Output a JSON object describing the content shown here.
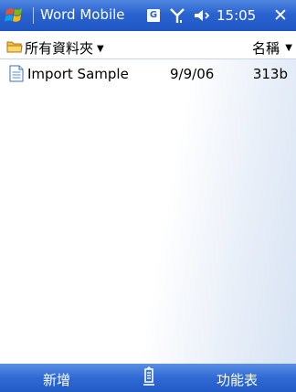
{
  "titlebar": {
    "app_title": "Word Mobile",
    "g_badge": "G",
    "time": "15:05",
    "close_glyph": "✕",
    "icons": [
      "windows-start-icon",
      "g-badge-icon",
      "signal-icon",
      "speaker-icon",
      "close-icon"
    ]
  },
  "folder_bar": {
    "folder_label": "所有資料夾",
    "sort_label": "名稱",
    "caret": "▼"
  },
  "files": [
    {
      "name": "Import Sample",
      "date": "9/9/06",
      "size": "313b",
      "icon": "document-icon"
    }
  ],
  "bottombar": {
    "left_softkey": "新增",
    "right_softkey": "功能表",
    "center_icon": "keyboard-icon"
  },
  "colors": {
    "titlebar": "#2a63d0",
    "bottombar": "#2f69d3",
    "text": "#000000"
  }
}
